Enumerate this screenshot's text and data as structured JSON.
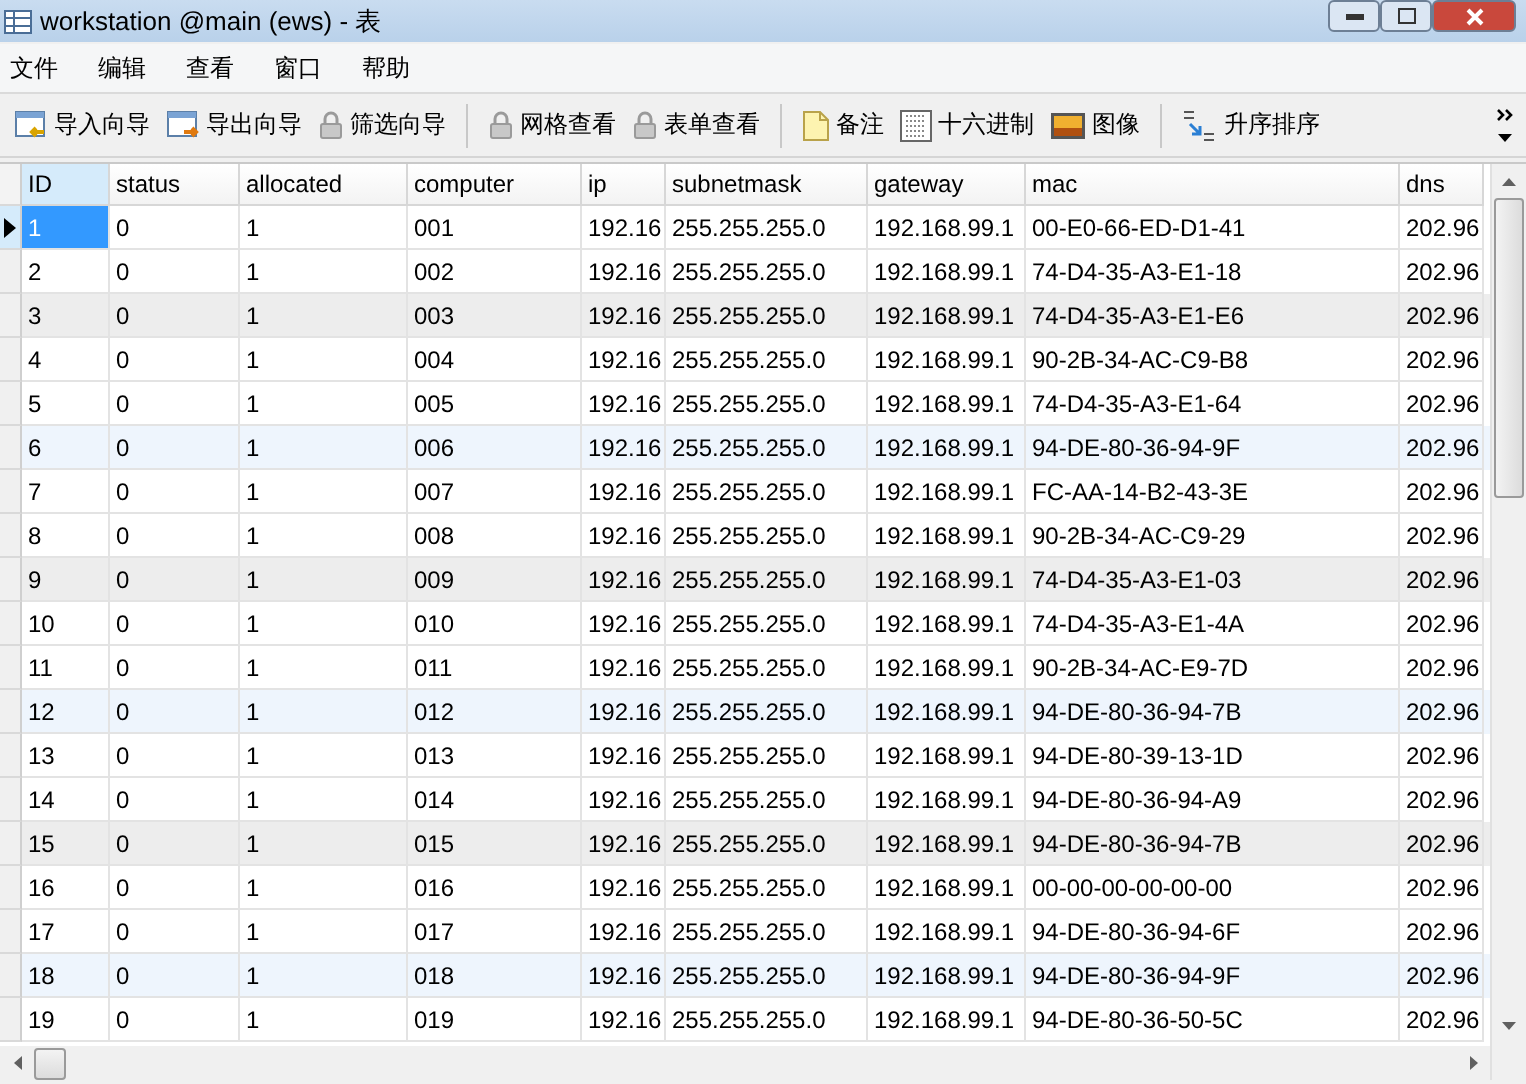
{
  "window": {
    "title": "workstation @main (ews) - 表"
  },
  "menu": [
    "文件",
    "编辑",
    "查看",
    "窗口",
    "帮助"
  ],
  "toolbar": [
    {
      "kind": "import",
      "label": "导入向导"
    },
    {
      "kind": "export",
      "label": "导出向导"
    },
    {
      "kind": "lock",
      "label": "筛选向导"
    },
    {
      "kind": "separator"
    },
    {
      "kind": "lock",
      "label": "网格查看"
    },
    {
      "kind": "lock",
      "label": "表单查看"
    },
    {
      "kind": "separator"
    },
    {
      "kind": "note",
      "label": "备注"
    },
    {
      "kind": "hex",
      "label": "十六进制"
    },
    {
      "kind": "image",
      "label": "图像"
    },
    {
      "kind": "separator"
    },
    {
      "kind": "sort",
      "label": "升序排序"
    }
  ],
  "table": {
    "columns": [
      "ID",
      "status",
      "allocated",
      "computer",
      "ip",
      "subnetmask",
      "gateway",
      "mac",
      "dns"
    ],
    "rows": [
      {
        "selected": true,
        "color": "#ffffff",
        "cells": [
          "1",
          "0",
          "1",
          "001",
          "192.16",
          "255.255.255.0",
          "192.168.99.1",
          "00-E0-66-ED-D1-41",
          "202.96"
        ]
      },
      {
        "selected": false,
        "color": "#ffffff",
        "cells": [
          "2",
          "0",
          "1",
          "002",
          "192.16",
          "255.255.255.0",
          "192.168.99.1",
          "74-D4-35-A3-E1-18",
          "202.96"
        ]
      },
      {
        "selected": false,
        "color": "#ededed",
        "cells": [
          "3",
          "0",
          "1",
          "003",
          "192.16",
          "255.255.255.0",
          "192.168.99.1",
          "74-D4-35-A3-E1-E6",
          "202.96"
        ]
      },
      {
        "selected": false,
        "color": "#ffffff",
        "cells": [
          "4",
          "0",
          "1",
          "004",
          "192.16",
          "255.255.255.0",
          "192.168.99.1",
          "90-2B-34-AC-C9-B8",
          "202.96"
        ]
      },
      {
        "selected": false,
        "color": "#ffffff",
        "cells": [
          "5",
          "0",
          "1",
          "005",
          "192.16",
          "255.255.255.0",
          "192.168.99.1",
          "74-D4-35-A3-E1-64",
          "202.96"
        ]
      },
      {
        "selected": false,
        "color": "#eef5fd",
        "cells": [
          "6",
          "0",
          "1",
          "006",
          "192.16",
          "255.255.255.0",
          "192.168.99.1",
          "94-DE-80-36-94-9F",
          "202.96"
        ]
      },
      {
        "selected": false,
        "color": "#ffffff",
        "cells": [
          "7",
          "0",
          "1",
          "007",
          "192.16",
          "255.255.255.0",
          "192.168.99.1",
          "FC-AA-14-B2-43-3E",
          "202.96"
        ]
      },
      {
        "selected": false,
        "color": "#ffffff",
        "cells": [
          "8",
          "0",
          "1",
          "008",
          "192.16",
          "255.255.255.0",
          "192.168.99.1",
          "90-2B-34-AC-C9-29",
          "202.96"
        ]
      },
      {
        "selected": false,
        "color": "#ededed",
        "cells": [
          "9",
          "0",
          "1",
          "009",
          "192.16",
          "255.255.255.0",
          "192.168.99.1",
          "74-D4-35-A3-E1-03",
          "202.96"
        ]
      },
      {
        "selected": false,
        "color": "#ffffff",
        "cells": [
          "10",
          "0",
          "1",
          "010",
          "192.16",
          "255.255.255.0",
          "192.168.99.1",
          "74-D4-35-A3-E1-4A",
          "202.96"
        ]
      },
      {
        "selected": false,
        "color": "#ffffff",
        "cells": [
          "11",
          "0",
          "1",
          "011",
          "192.16",
          "255.255.255.0",
          "192.168.99.1",
          "90-2B-34-AC-E9-7D",
          "202.96"
        ]
      },
      {
        "selected": false,
        "color": "#eef5fd",
        "cells": [
          "12",
          "0",
          "1",
          "012",
          "192.16",
          "255.255.255.0",
          "192.168.99.1",
          "94-DE-80-36-94-7B",
          "202.96"
        ]
      },
      {
        "selected": false,
        "color": "#ffffff",
        "cells": [
          "13",
          "0",
          "1",
          "013",
          "192.16",
          "255.255.255.0",
          "192.168.99.1",
          "94-DE-80-39-13-1D",
          "202.96"
        ]
      },
      {
        "selected": false,
        "color": "#ffffff",
        "cells": [
          "14",
          "0",
          "1",
          "014",
          "192.16",
          "255.255.255.0",
          "192.168.99.1",
          "94-DE-80-36-94-A9",
          "202.96"
        ]
      },
      {
        "selected": false,
        "color": "#ededed",
        "cells": [
          "15",
          "0",
          "1",
          "015",
          "192.16",
          "255.255.255.0",
          "192.168.99.1",
          "94-DE-80-36-94-7B",
          "202.96"
        ]
      },
      {
        "selected": false,
        "color": "#ffffff",
        "cells": [
          "16",
          "0",
          "1",
          "016",
          "192.16",
          "255.255.255.0",
          "192.168.99.1",
          "00-00-00-00-00-00",
          "202.96"
        ]
      },
      {
        "selected": false,
        "color": "#ffffff",
        "cells": [
          "17",
          "0",
          "1",
          "017",
          "192.16",
          "255.255.255.0",
          "192.168.99.1",
          "94-DE-80-36-94-6F",
          "202.96"
        ]
      },
      {
        "selected": false,
        "color": "#eef5fd",
        "cells": [
          "18",
          "0",
          "1",
          "018",
          "192.16",
          "255.255.255.0",
          "192.168.99.1",
          "94-DE-80-36-94-9F",
          "202.96"
        ]
      },
      {
        "selected": false,
        "color": "#ffffff",
        "cells": [
          "19",
          "0",
          "1",
          "019",
          "192.16",
          "255.255.255.0",
          "192.168.99.1",
          "94-DE-80-36-50-5C",
          "202.96"
        ]
      }
    ]
  }
}
